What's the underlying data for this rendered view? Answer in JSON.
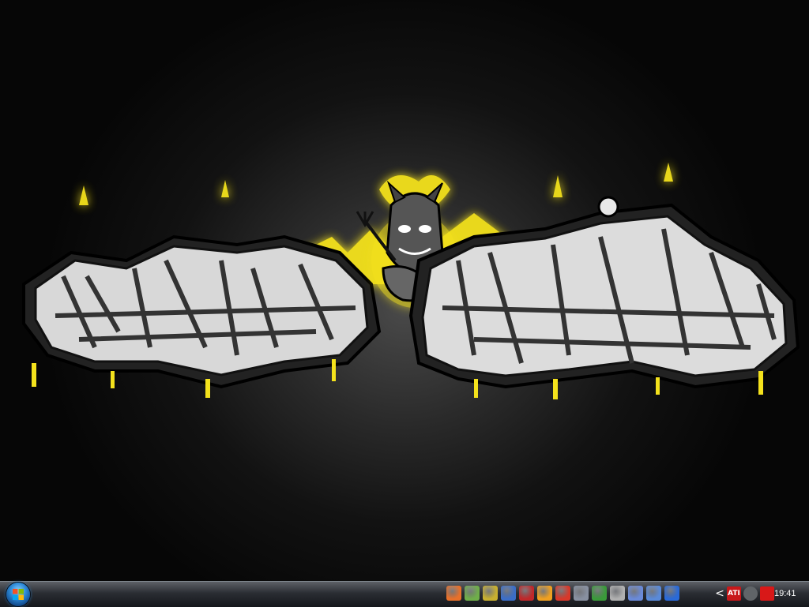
{
  "desktop": {
    "wallpaper": {
      "description_icon": "graffiti-wallpaper",
      "accent": "#f5e300"
    }
  },
  "taskbar": {
    "start_button_icon": "windows-logo-icon",
    "quick_launch": [
      {
        "icon": "firefox-icon",
        "color": "#e8702a"
      },
      {
        "icon": "recycle-bin-icon",
        "color": "#6fae4a"
      },
      {
        "icon": "winamp-icon",
        "color": "#c8b030"
      },
      {
        "icon": "itunes-icon",
        "color": "#3b6ec8"
      },
      {
        "icon": "filezilla-icon",
        "color": "#c0282a"
      },
      {
        "icon": "orange-app-icon",
        "color": "#f0a020"
      },
      {
        "icon": "red-app-icon",
        "color": "#d8382a"
      },
      {
        "icon": "window-app-icon",
        "color": "#8890a0"
      },
      {
        "icon": "flower-app-icon",
        "color": "#3a9a3a"
      },
      {
        "icon": "gear-icon",
        "color": "#b0b0b0"
      },
      {
        "icon": "globe-icon",
        "color": "#6a8ad8"
      },
      {
        "icon": "file-icon",
        "color": "#5a8ad8"
      },
      {
        "icon": "media-player-icon",
        "color": "#2a6ad8"
      }
    ],
    "tray": {
      "chevron": "<",
      "icons": [
        {
          "icon": "ati-icon",
          "label": "ATI",
          "color": "#c8181a"
        },
        {
          "icon": "network-icon",
          "label": "",
          "color": "#606468"
        },
        {
          "icon": "antivirus-icon",
          "label": "",
          "color": "#d81818"
        }
      ],
      "clock": "19:41"
    }
  }
}
